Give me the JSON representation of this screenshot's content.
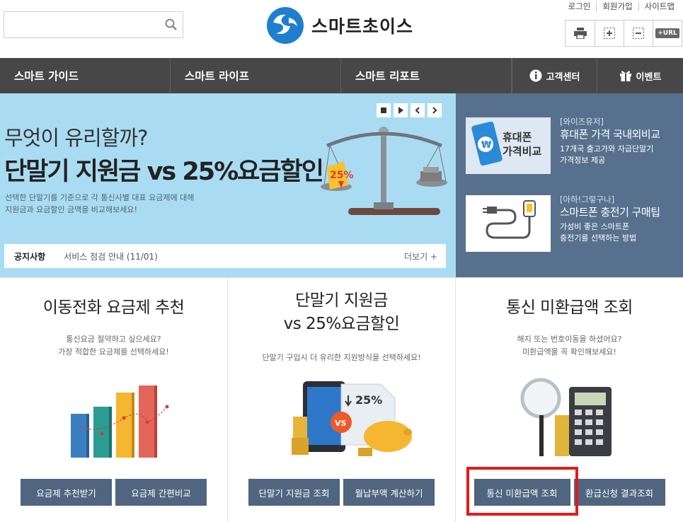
{
  "header": {
    "logo_text": "스마트초이스",
    "search_placeholder": "",
    "util_links": [
      "로그인",
      "회원가입",
      "사이트맵"
    ],
    "tools": [
      "print-icon",
      "zoom-in-icon",
      "zoom-out-icon",
      "url-copy-icon"
    ],
    "tool_url_label": "+URL"
  },
  "nav": {
    "items": [
      "스마트 가이드",
      "스마트 라이프",
      "스마트 리포트"
    ],
    "customer_center": "고객센터",
    "event": "이벤트"
  },
  "banner": {
    "title_line1": "무엇이 유리할까?",
    "title_line2": "단말기 지원금 vs 25%요금할인",
    "desc_line1": "선택한 단말기를 기준으로 각 통신사별 대표 요금제에 대해",
    "desc_line2": "지원금과 요금할인 금액을 비교해보세요!",
    "badge": "25%",
    "controls": [
      "stop-icon",
      "play-icon",
      "prev-icon",
      "next-icon"
    ],
    "background": "#a9dcf3"
  },
  "notice": {
    "label": "공지사항",
    "text": "서비스 점검 안내 (11/01)",
    "more": "더보기 +"
  },
  "side": {
    "cards": [
      {
        "tag": "[와이즈유저]",
        "title": "휴대폰 가격 국내외비교",
        "desc1": "17개국 출고가와 자급단말기",
        "desc2": "가격정보 제공",
        "img_label1": "휴대폰",
        "img_label2": "가격비교"
      },
      {
        "tag": "[아하!그렇구나]",
        "title": "스마트폰 충전기 구매팁",
        "desc1": "가성비 좋은 스마트폰",
        "desc2": "충전기를 선택하는 방법"
      }
    ],
    "background": "#57708d"
  },
  "columns": [
    {
      "title": "이동전화 요금제 추천",
      "desc1": "통신요금 절약하고 싶으세요?",
      "desc2": "가장 적합한 요금제를 선택하세요!",
      "buttons": [
        "요금제 추천받기",
        "요금제 간편비교"
      ]
    },
    {
      "title1": "단말기 지원금",
      "title2": "vs 25%요금할인",
      "desc1": "단말기 구입시 더 유리한 지원방식을 선택하세요!",
      "buttons": [
        "단말기 지원금 조회",
        "월납부액 계산하기"
      ],
      "vs_badge": "VS",
      "doc_percent": "25%"
    },
    {
      "title": "통신 미환급액 조회",
      "desc1": "해지 또는 번호이동을 하셨어요?",
      "desc2": "미환급액을 꼭 확인해보세요!",
      "buttons": [
        "통신 미환급액 조회",
        "환급신청 결과조회"
      ]
    }
  ],
  "colors": {
    "nav": "#474747",
    "button": "#4f6580",
    "highlight": "#e01c1c"
  }
}
